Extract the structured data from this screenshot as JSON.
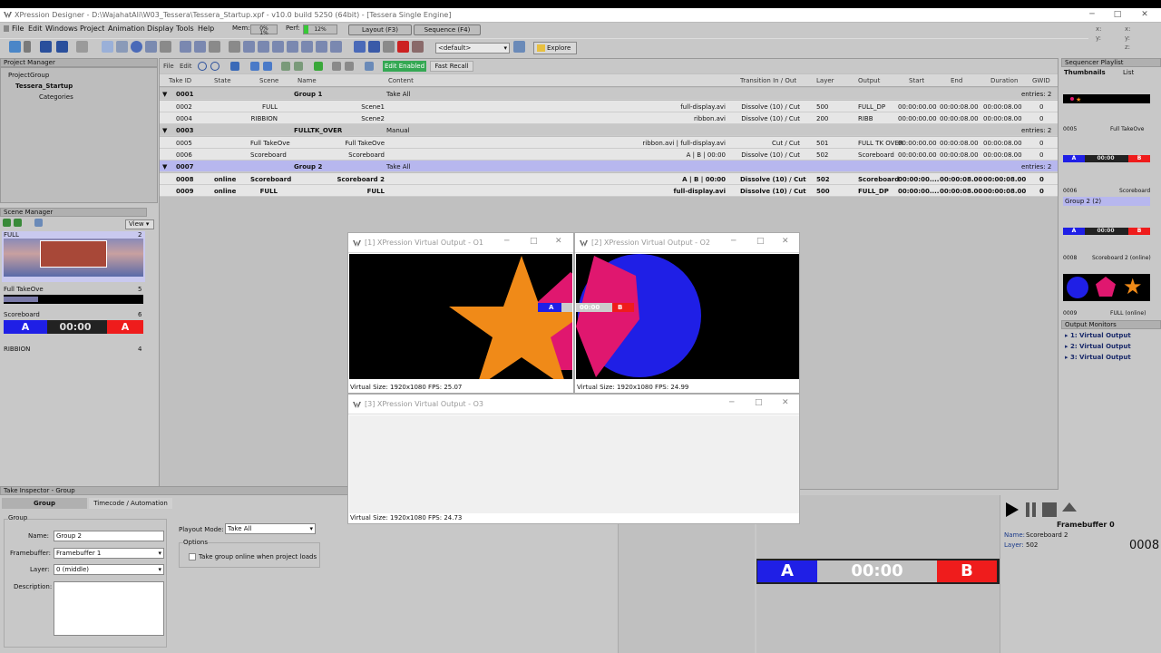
{
  "window": {
    "title": "XPression Designer - D:\\WajahatAli\\W03_Tessera\\Tessera_Startup.xpf - v10.0 build 5250 (64bit) - [Tessera Single Engine]",
    "min": "─",
    "max": "□",
    "close": "✕"
  },
  "menu": [
    "File",
    "Edit",
    "Windows",
    "Project",
    "Animation",
    "Display",
    "Tools",
    "Help"
  ],
  "status": {
    "mem_label": "Mem:",
    "mem_vals": [
      "0%",
      "1%"
    ],
    "perf_label": "Perf:",
    "perf_value": "12%",
    "layout_btn": "Layout (F3)",
    "sequence_btn": "Sequence (F4)",
    "default_select": "<default>",
    "explore_btn": "Explore"
  },
  "coords": {
    "x1": "x:",
    "y1": "y:",
    "z1": "z:",
    "x2": "x:",
    "y2": "y:",
    "z2": "z:"
  },
  "project_manager": {
    "title": "Project Manager",
    "items": [
      "ProjectGroup",
      "Tessera_Startup",
      "Categories"
    ]
  },
  "scene_manager": {
    "title": "Scene Manager",
    "view_btn": "View",
    "scenes": [
      {
        "name": "FULL",
        "num": "2"
      },
      {
        "name": "Full TakeOve",
        "num": "5"
      },
      {
        "name": "Scoreboard",
        "num": "6"
      },
      {
        "name": "RIBBION",
        "num": "4"
      }
    ]
  },
  "takes_toolbar": {
    "file": "File",
    "edit": "Edit",
    "edit_enabled": "Edit Enabled",
    "fast_recall": "Fast Recall"
  },
  "columns": [
    "Take ID",
    "State",
    "Scene",
    "Name",
    "Content",
    "Transition In / Out",
    "Layer",
    "Output",
    "Start",
    "End",
    "Duration",
    "GWID"
  ],
  "groups": [
    {
      "id": "0001",
      "name": "Group 1",
      "content": "Take All",
      "entries": "entries: 2",
      "rows": [
        {
          "id": "0002",
          "state": "",
          "scene": "FULL",
          "name": "Scene1",
          "content": "full-display.avi",
          "trans": "Dissolve (10) / Cut",
          "layer": "500",
          "output": "FULL_DP",
          "start": "00:00:00.00",
          "end": "00:00:08.00",
          "dur": "00:00:08.00",
          "gwid": "0"
        },
        {
          "id": "0004",
          "state": "",
          "scene": "RIBBION",
          "name": "Scene2",
          "content": "ribbon.avi",
          "trans": "Dissolve (10) / Cut",
          "layer": "200",
          "output": "RIBB",
          "start": "00:00:00.00",
          "end": "00:00:08.00",
          "dur": "00:00:08.00",
          "gwid": "0"
        }
      ]
    },
    {
      "id": "0003",
      "name": "FULLTK_OVER",
      "content": "Manual",
      "entries": "entries: 2",
      "rows": [
        {
          "id": "0005",
          "state": "",
          "scene": "Full TakeOve",
          "name": "Full TakeOve",
          "content": "ribbon.avi | full-display.avi",
          "trans": "Cut / Cut",
          "layer": "501",
          "output": "FULL TK OVER",
          "start": "00:00:00.00",
          "end": "00:00:08.00",
          "dur": "00:00:08.00",
          "gwid": "0"
        },
        {
          "id": "0006",
          "state": "",
          "scene": "Scoreboard",
          "name": "Scoreboard",
          "content": "A | B | 00:00",
          "trans": "Dissolve (10) / Cut",
          "layer": "502",
          "output": "Scoreboard",
          "start": "00:00:00.00",
          "end": "00:00:08.00",
          "dur": "00:00:08.00",
          "gwid": "0"
        }
      ]
    },
    {
      "id": "0007",
      "name": "Group 2",
      "content": "Take All",
      "entries": "entries: 2",
      "rows": [
        {
          "id": "0008",
          "state": "online",
          "scene": "Scoreboard",
          "name": "Scoreboard 2",
          "content": "A | B | 00:00",
          "trans": "Dissolve (10) / Cut",
          "layer": "502",
          "output": "Scoreboard",
          "start": "00:00:00....",
          "end": "00:00:08.00",
          "dur": "00:00:08.00",
          "gwid": "0"
        },
        {
          "id": "0009",
          "state": "online",
          "scene": "FULL",
          "name": "FULL",
          "content": "full-display.avi",
          "trans": "Dissolve (10) / Cut",
          "layer": "500",
          "output": "FULL_DP",
          "start": "00:00:00....",
          "end": "00:00:08.00",
          "dur": "00:00:08.00",
          "gwid": "0"
        }
      ]
    }
  ],
  "outputs": [
    {
      "title": "[1] XPression Virtual Output - O1",
      "info": "Virtual Size: 1920x1080  FPS: 25.07"
    },
    {
      "title": "[2] XPression Virtual Output - O2",
      "info": "Virtual Size: 1920x1080  FPS: 24.99"
    },
    {
      "title": "[3] XPression Virtual Output - O3",
      "info": "Virtual Size: 1920x1080  FPS: 24.73"
    }
  ],
  "scoreboard": {
    "a": "A",
    "b": "B",
    "time": "00:00"
  },
  "sequencer": {
    "title": "Sequencer Playlist",
    "tab_thumbs": "Thumbnails",
    "tab_list": "List",
    "items": [
      {
        "id": "0005",
        "name": "Full TakeOve"
      },
      {
        "id": "0006",
        "name": "Scoreboard"
      },
      {
        "id": "0008",
        "name": "Scoreboard 2 (online)"
      },
      {
        "id": "0009",
        "name": "FULL (online)"
      }
    ],
    "group": "Group 2  (2)"
  },
  "output_monitors": {
    "title": "Output Monitors",
    "items": [
      "1: Virtual Output",
      "2: Virtual Output",
      "3: Virtual Output"
    ]
  },
  "inspector": {
    "title": "Take Inspector - Group",
    "tab_group": "Group",
    "tab_timecode": "Timecode / Automation",
    "group_label": "Group",
    "name_label": "Name:",
    "name_value": "Group 2",
    "fb_label": "Framebuffer:",
    "fb_value": "Framebuffer 1",
    "layer_label": "Layer:",
    "layer_value": "0 (middle)",
    "desc_label": "Description:",
    "playout_label": "Playout Mode:",
    "playout_value": "Take All",
    "options_label": "Options",
    "checkbox_label": "Take group online when project loads"
  },
  "framebuffer": {
    "title": "Framebuffer 0",
    "name_label": "Name:",
    "name_value": "Scoreboard 2",
    "layer_label": "Layer:",
    "layer_value": "502",
    "id": "0008"
  },
  "colors": {
    "blue": "#1f1fe6",
    "red": "#ef1c1c",
    "star": "#f08a18",
    "pink": "#e0176f",
    "accent": "#34a853"
  }
}
